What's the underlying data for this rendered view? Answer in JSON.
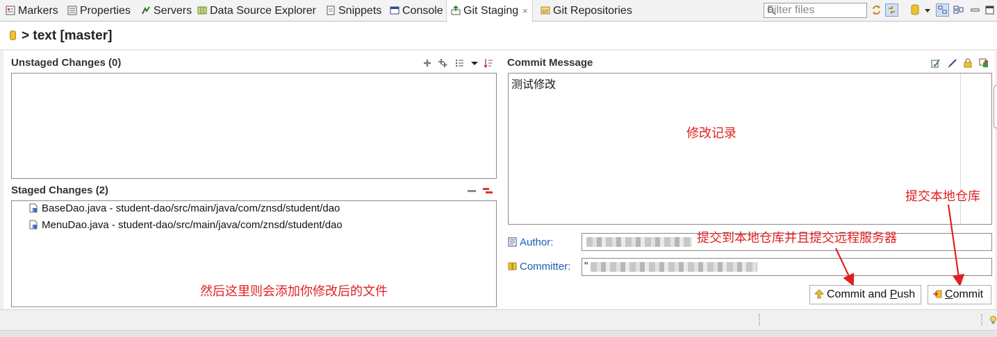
{
  "tabs": [
    {
      "label": "Markers",
      "icon": "markers-icon"
    },
    {
      "label": "Properties",
      "icon": "properties-icon"
    },
    {
      "label": "Servers",
      "icon": "servers-icon"
    },
    {
      "label": "Data Source Explorer",
      "icon": "data-source-icon"
    },
    {
      "label": "Snippets",
      "icon": "snippets-icon"
    },
    {
      "label": "Console",
      "icon": "console-icon"
    },
    {
      "label": "Git Staging",
      "icon": "git-staging-icon",
      "active": true,
      "close": "×"
    },
    {
      "label": "Git Repositories",
      "icon": "git-repositories-icon"
    }
  ],
  "toolbar": {
    "filter_placeholder": "Filter files"
  },
  "header": {
    "repo_title": "> text [master]"
  },
  "unstaged": {
    "title": "Unstaged Changes (0)"
  },
  "staged": {
    "title": "Staged Changes (2)",
    "files": [
      {
        "name": "BaseDao.java - student-dao/src/main/java/com/znsd/student/dao"
      },
      {
        "name": "MenuDao.java - student-dao/src/main/java/com/znsd/student/dao"
      }
    ]
  },
  "commit": {
    "title": "Commit Message",
    "message": "测试修改",
    "author_label": "Author:",
    "committer_label": "Committer:",
    "committer_prefix": "\"",
    "commit_and_push_pre": "Commit and ",
    "commit_and_push_u": "P",
    "commit_and_push_post": "ush",
    "commit_u": "C",
    "commit_post": "ommit"
  },
  "annotations": {
    "commit_record": "修改记录",
    "commit_local": "提交本地仓库",
    "commit_push": "提交到本地仓库并且提交远程服务器",
    "staged_note": "然后这里则会添加你修改后的文件"
  },
  "colors": {
    "annotation": "#e02020",
    "link": "#1a5bb0",
    "tab_active_bg": "#ffffff"
  }
}
